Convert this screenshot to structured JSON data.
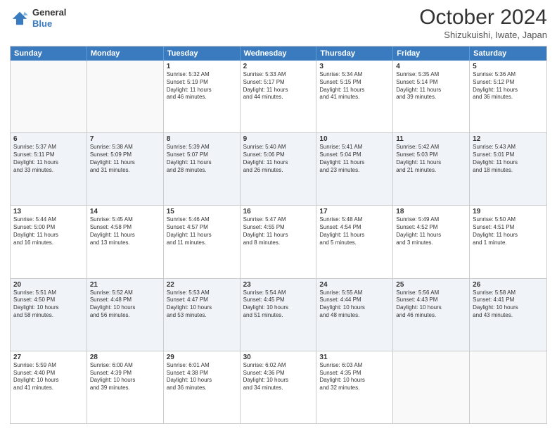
{
  "logo": {
    "line1": "General",
    "line2": "Blue"
  },
  "title": "October 2024",
  "location": "Shizukuishi, Iwate, Japan",
  "days_of_week": [
    "Sunday",
    "Monday",
    "Tuesday",
    "Wednesday",
    "Thursday",
    "Friday",
    "Saturday"
  ],
  "weeks": [
    [
      {
        "day": "",
        "lines": [],
        "empty": true
      },
      {
        "day": "",
        "lines": [],
        "empty": true
      },
      {
        "day": "1",
        "lines": [
          "Sunrise: 5:32 AM",
          "Sunset: 5:19 PM",
          "Daylight: 11 hours",
          "and 46 minutes."
        ],
        "empty": false
      },
      {
        "day": "2",
        "lines": [
          "Sunrise: 5:33 AM",
          "Sunset: 5:17 PM",
          "Daylight: 11 hours",
          "and 44 minutes."
        ],
        "empty": false
      },
      {
        "day": "3",
        "lines": [
          "Sunrise: 5:34 AM",
          "Sunset: 5:15 PM",
          "Daylight: 11 hours",
          "and 41 minutes."
        ],
        "empty": false
      },
      {
        "day": "4",
        "lines": [
          "Sunrise: 5:35 AM",
          "Sunset: 5:14 PM",
          "Daylight: 11 hours",
          "and 39 minutes."
        ],
        "empty": false
      },
      {
        "day": "5",
        "lines": [
          "Sunrise: 5:36 AM",
          "Sunset: 5:12 PM",
          "Daylight: 11 hours",
          "and 36 minutes."
        ],
        "empty": false
      }
    ],
    [
      {
        "day": "6",
        "lines": [
          "Sunrise: 5:37 AM",
          "Sunset: 5:11 PM",
          "Daylight: 11 hours",
          "and 33 minutes."
        ],
        "empty": false
      },
      {
        "day": "7",
        "lines": [
          "Sunrise: 5:38 AM",
          "Sunset: 5:09 PM",
          "Daylight: 11 hours",
          "and 31 minutes."
        ],
        "empty": false
      },
      {
        "day": "8",
        "lines": [
          "Sunrise: 5:39 AM",
          "Sunset: 5:07 PM",
          "Daylight: 11 hours",
          "and 28 minutes."
        ],
        "empty": false
      },
      {
        "day": "9",
        "lines": [
          "Sunrise: 5:40 AM",
          "Sunset: 5:06 PM",
          "Daylight: 11 hours",
          "and 26 minutes."
        ],
        "empty": false
      },
      {
        "day": "10",
        "lines": [
          "Sunrise: 5:41 AM",
          "Sunset: 5:04 PM",
          "Daylight: 11 hours",
          "and 23 minutes."
        ],
        "empty": false
      },
      {
        "day": "11",
        "lines": [
          "Sunrise: 5:42 AM",
          "Sunset: 5:03 PM",
          "Daylight: 11 hours",
          "and 21 minutes."
        ],
        "empty": false
      },
      {
        "day": "12",
        "lines": [
          "Sunrise: 5:43 AM",
          "Sunset: 5:01 PM",
          "Daylight: 11 hours",
          "and 18 minutes."
        ],
        "empty": false
      }
    ],
    [
      {
        "day": "13",
        "lines": [
          "Sunrise: 5:44 AM",
          "Sunset: 5:00 PM",
          "Daylight: 11 hours",
          "and 16 minutes."
        ],
        "empty": false
      },
      {
        "day": "14",
        "lines": [
          "Sunrise: 5:45 AM",
          "Sunset: 4:58 PM",
          "Daylight: 11 hours",
          "and 13 minutes."
        ],
        "empty": false
      },
      {
        "day": "15",
        "lines": [
          "Sunrise: 5:46 AM",
          "Sunset: 4:57 PM",
          "Daylight: 11 hours",
          "and 11 minutes."
        ],
        "empty": false
      },
      {
        "day": "16",
        "lines": [
          "Sunrise: 5:47 AM",
          "Sunset: 4:55 PM",
          "Daylight: 11 hours",
          "and 8 minutes."
        ],
        "empty": false
      },
      {
        "day": "17",
        "lines": [
          "Sunrise: 5:48 AM",
          "Sunset: 4:54 PM",
          "Daylight: 11 hours",
          "and 5 minutes."
        ],
        "empty": false
      },
      {
        "day": "18",
        "lines": [
          "Sunrise: 5:49 AM",
          "Sunset: 4:52 PM",
          "Daylight: 11 hours",
          "and 3 minutes."
        ],
        "empty": false
      },
      {
        "day": "19",
        "lines": [
          "Sunrise: 5:50 AM",
          "Sunset: 4:51 PM",
          "Daylight: 11 hours",
          "and 1 minute."
        ],
        "empty": false
      }
    ],
    [
      {
        "day": "20",
        "lines": [
          "Sunrise: 5:51 AM",
          "Sunset: 4:50 PM",
          "Daylight: 10 hours",
          "and 58 minutes."
        ],
        "empty": false
      },
      {
        "day": "21",
        "lines": [
          "Sunrise: 5:52 AM",
          "Sunset: 4:48 PM",
          "Daylight: 10 hours",
          "and 56 minutes."
        ],
        "empty": false
      },
      {
        "day": "22",
        "lines": [
          "Sunrise: 5:53 AM",
          "Sunset: 4:47 PM",
          "Daylight: 10 hours",
          "and 53 minutes."
        ],
        "empty": false
      },
      {
        "day": "23",
        "lines": [
          "Sunrise: 5:54 AM",
          "Sunset: 4:45 PM",
          "Daylight: 10 hours",
          "and 51 minutes."
        ],
        "empty": false
      },
      {
        "day": "24",
        "lines": [
          "Sunrise: 5:55 AM",
          "Sunset: 4:44 PM",
          "Daylight: 10 hours",
          "and 48 minutes."
        ],
        "empty": false
      },
      {
        "day": "25",
        "lines": [
          "Sunrise: 5:56 AM",
          "Sunset: 4:43 PM",
          "Daylight: 10 hours",
          "and 46 minutes."
        ],
        "empty": false
      },
      {
        "day": "26",
        "lines": [
          "Sunrise: 5:58 AM",
          "Sunset: 4:41 PM",
          "Daylight: 10 hours",
          "and 43 minutes."
        ],
        "empty": false
      }
    ],
    [
      {
        "day": "27",
        "lines": [
          "Sunrise: 5:59 AM",
          "Sunset: 4:40 PM",
          "Daylight: 10 hours",
          "and 41 minutes."
        ],
        "empty": false
      },
      {
        "day": "28",
        "lines": [
          "Sunrise: 6:00 AM",
          "Sunset: 4:39 PM",
          "Daylight: 10 hours",
          "and 39 minutes."
        ],
        "empty": false
      },
      {
        "day": "29",
        "lines": [
          "Sunrise: 6:01 AM",
          "Sunset: 4:38 PM",
          "Daylight: 10 hours",
          "and 36 minutes."
        ],
        "empty": false
      },
      {
        "day": "30",
        "lines": [
          "Sunrise: 6:02 AM",
          "Sunset: 4:36 PM",
          "Daylight: 10 hours",
          "and 34 minutes."
        ],
        "empty": false
      },
      {
        "day": "31",
        "lines": [
          "Sunrise: 6:03 AM",
          "Sunset: 4:35 PM",
          "Daylight: 10 hours",
          "and 32 minutes."
        ],
        "empty": false
      },
      {
        "day": "",
        "lines": [],
        "empty": true
      },
      {
        "day": "",
        "lines": [],
        "empty": true
      }
    ]
  ]
}
